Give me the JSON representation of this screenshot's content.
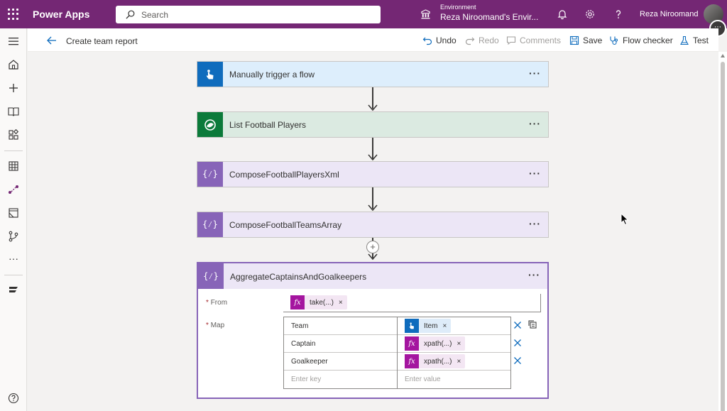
{
  "app": {
    "name": "Power Apps"
  },
  "search": {
    "placeholder": "Search"
  },
  "environment": {
    "label": "Environment",
    "name": "Reza Niroomand's Envir..."
  },
  "user": {
    "name": "Reza Niroomand"
  },
  "command_bar": {
    "page_title": "Create team report",
    "undo": "Undo",
    "redo": "Redo",
    "comments": "Comments",
    "save": "Save",
    "flow_checker": "Flow checker",
    "test": "Test"
  },
  "flow": {
    "steps": [
      {
        "title": "Manually trigger a flow",
        "icon": "touch-icon",
        "color": "#0f6cbd",
        "bg": "#ddeefc"
      },
      {
        "title": "List Football Players",
        "icon": "dataverse-icon",
        "color": "#0b7a3a",
        "bg": "#dbeae1"
      },
      {
        "title": "ComposeFootballPlayersXml",
        "icon": "compose-icon",
        "color": "#8764b8",
        "bg": "#ece6f6"
      },
      {
        "title": "ComposeFootballTeamsArray",
        "icon": "compose-icon",
        "color": "#8764b8",
        "bg": "#ece6f6"
      }
    ],
    "select_action": {
      "title": "AggregateCaptainsAndGoalkeepers",
      "from_label": "From",
      "from_token": "take(...)",
      "map_label": "Map",
      "rows": [
        {
          "key": "Team",
          "value": "Item",
          "token_type": "trigger"
        },
        {
          "key": "Captain",
          "value": "xpath(...)",
          "token_type": "expression"
        },
        {
          "key": "Goalkeeper",
          "value": "xpath(...)",
          "token_type": "expression"
        }
      ],
      "new_key_placeholder": "Enter key",
      "new_value_placeholder": "Enter value"
    }
  },
  "colors": {
    "brand": "#742774",
    "accent": "#8764b8"
  }
}
